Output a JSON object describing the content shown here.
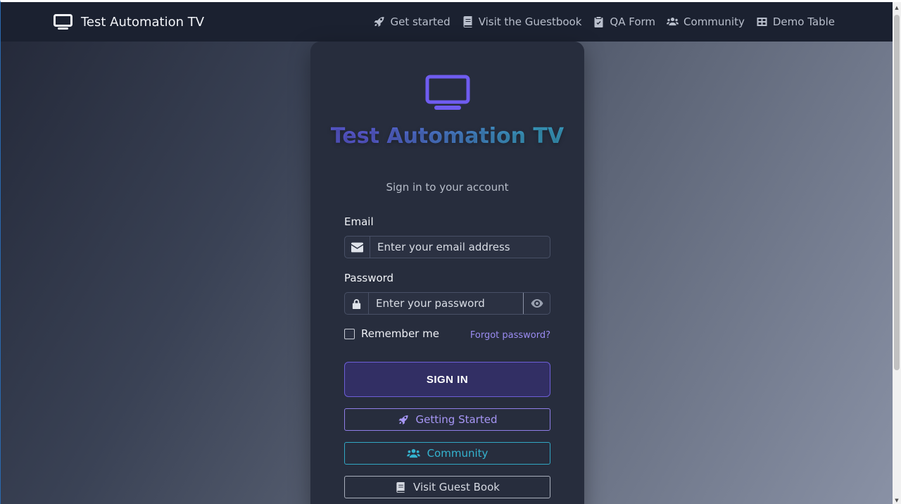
{
  "navbar": {
    "brand": "Test Automation TV",
    "links": [
      {
        "label": "Get started",
        "icon": "rocket-icon"
      },
      {
        "label": "Visit the Guestbook",
        "icon": "book-icon"
      },
      {
        "label": "QA Form",
        "icon": "clipboard-check-icon"
      },
      {
        "label": "Community",
        "icon": "users-icon"
      },
      {
        "label": "Demo Table",
        "icon": "table-icon"
      }
    ]
  },
  "card": {
    "title": "Test Automation TV",
    "subtitle": "Sign in to your account",
    "email": {
      "label": "Email",
      "placeholder": "Enter your email address",
      "icon": "envelope-icon"
    },
    "password": {
      "label": "Password",
      "placeholder": "Enter your password",
      "icon": "lock-icon",
      "toggle_icon": "eye-icon"
    },
    "remember_label": "Remember me",
    "remember_checked": false,
    "forgot_label": "Forgot password?",
    "signin_label": "SIGN IN",
    "buttons": {
      "getting_started": "Getting Started",
      "community": "Community",
      "guest_book": "Visit Guest Book"
    }
  },
  "colors": {
    "accent": "#6c5ce7",
    "teal": "#34b3cf",
    "navbar_bg": "#1b2130",
    "card_bg": "#272d3d"
  }
}
